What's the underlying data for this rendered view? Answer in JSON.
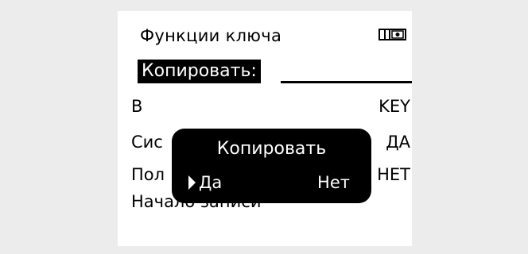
{
  "header": {
    "title": "Функции ключа",
    "icon": "key-card-icon"
  },
  "selection": {
    "label": "Копировать:"
  },
  "rows": [
    {
      "label": "В",
      "value": "KEY"
    },
    {
      "label": "Сис",
      "value": "ДА"
    },
    {
      "label": "Пол",
      "value": "НЕТ"
    },
    {
      "label": "Начало записи",
      "value": ""
    }
  ],
  "dialog": {
    "title": "Копировать",
    "yes_label": "Да",
    "no_label": "Нет",
    "selected": "yes"
  },
  "colors": {
    "background": "#ececec",
    "screen": "#ffffff",
    "ink": "#000000"
  }
}
